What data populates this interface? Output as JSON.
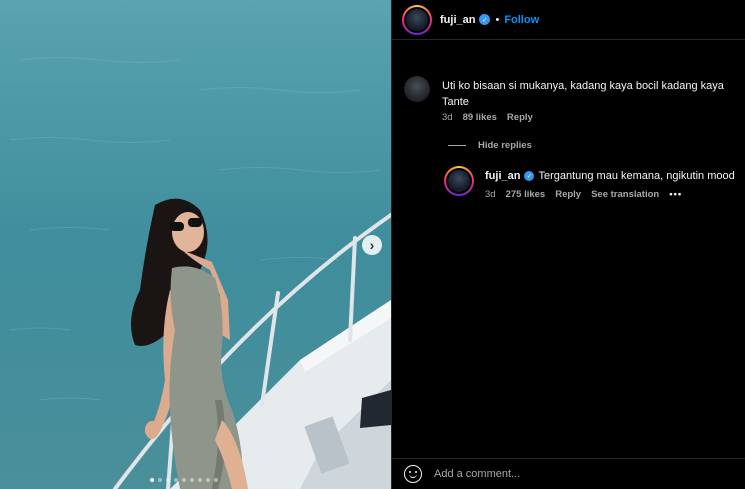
{
  "post": {
    "username": "fuji_an",
    "separator": "•",
    "follow_label": "Follow",
    "carousel": {
      "slides": 9,
      "active_index": 0
    },
    "next_glyph": "›"
  },
  "comments": [
    {
      "text": "Uti ko bisaan si mukanya, kadang kaya bocil kadang kaya Tante",
      "time": "3d",
      "likes": "89 likes",
      "reply_label": "Reply"
    }
  ],
  "hide_replies_label": "Hide replies",
  "reply": {
    "username": "fuji_an",
    "text": "Tergantung mau kemana, ngikutin mood",
    "time": "3d",
    "likes": "275 likes",
    "reply_label": "Reply",
    "translation_label": "See translation",
    "more_glyph": "•••"
  },
  "footer": {
    "placeholder": "Add a comment..."
  },
  "colors": {
    "accent": "#0095f6",
    "verified": "#3897f0",
    "background": "#000000",
    "muted": "#a8a8a8"
  },
  "icons": [
    "verified-badge-icon",
    "chevron-right-icon",
    "emoji-icon",
    "more-options-icon"
  ]
}
